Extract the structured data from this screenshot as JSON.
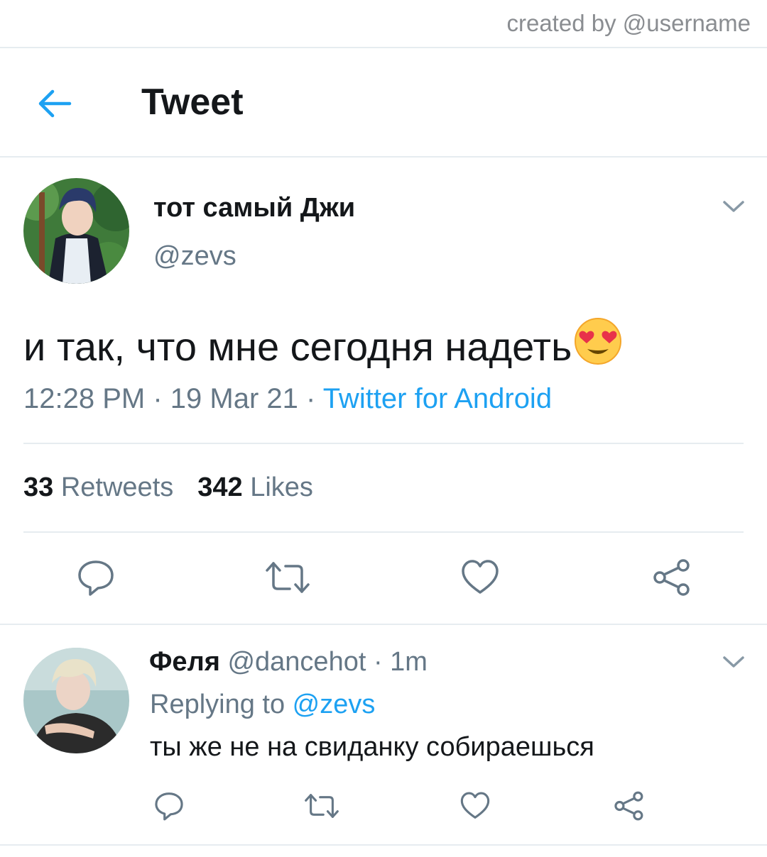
{
  "credit": "created by @username",
  "header": {
    "title": "Tweet",
    "back_icon": "back-arrow-icon"
  },
  "tweet": {
    "display_name": "тот самый Джи",
    "handle": "@zevs",
    "text": "и так, что мне сегодня надеть",
    "emoji": "smiling-face-with-heart-eyes",
    "time": "12:28 PM",
    "date": "19 Mar 21",
    "source": "Twitter for Android",
    "separator": " · ",
    "retweets_count": "33",
    "retweets_label": "Retweets",
    "likes_count": "342",
    "likes_label": "Likes"
  },
  "reply": {
    "display_name": "Феля",
    "handle": "@dancehot",
    "time": "1m",
    "replying_prefix": "Replying to ",
    "replying_to": "@zevs",
    "text": "ты же не на свиданку собираешься"
  },
  "colors": {
    "accent": "#1da1f2",
    "secondary_text": "#657786",
    "primary_text": "#14171a",
    "divider": "#e6ecf0"
  }
}
